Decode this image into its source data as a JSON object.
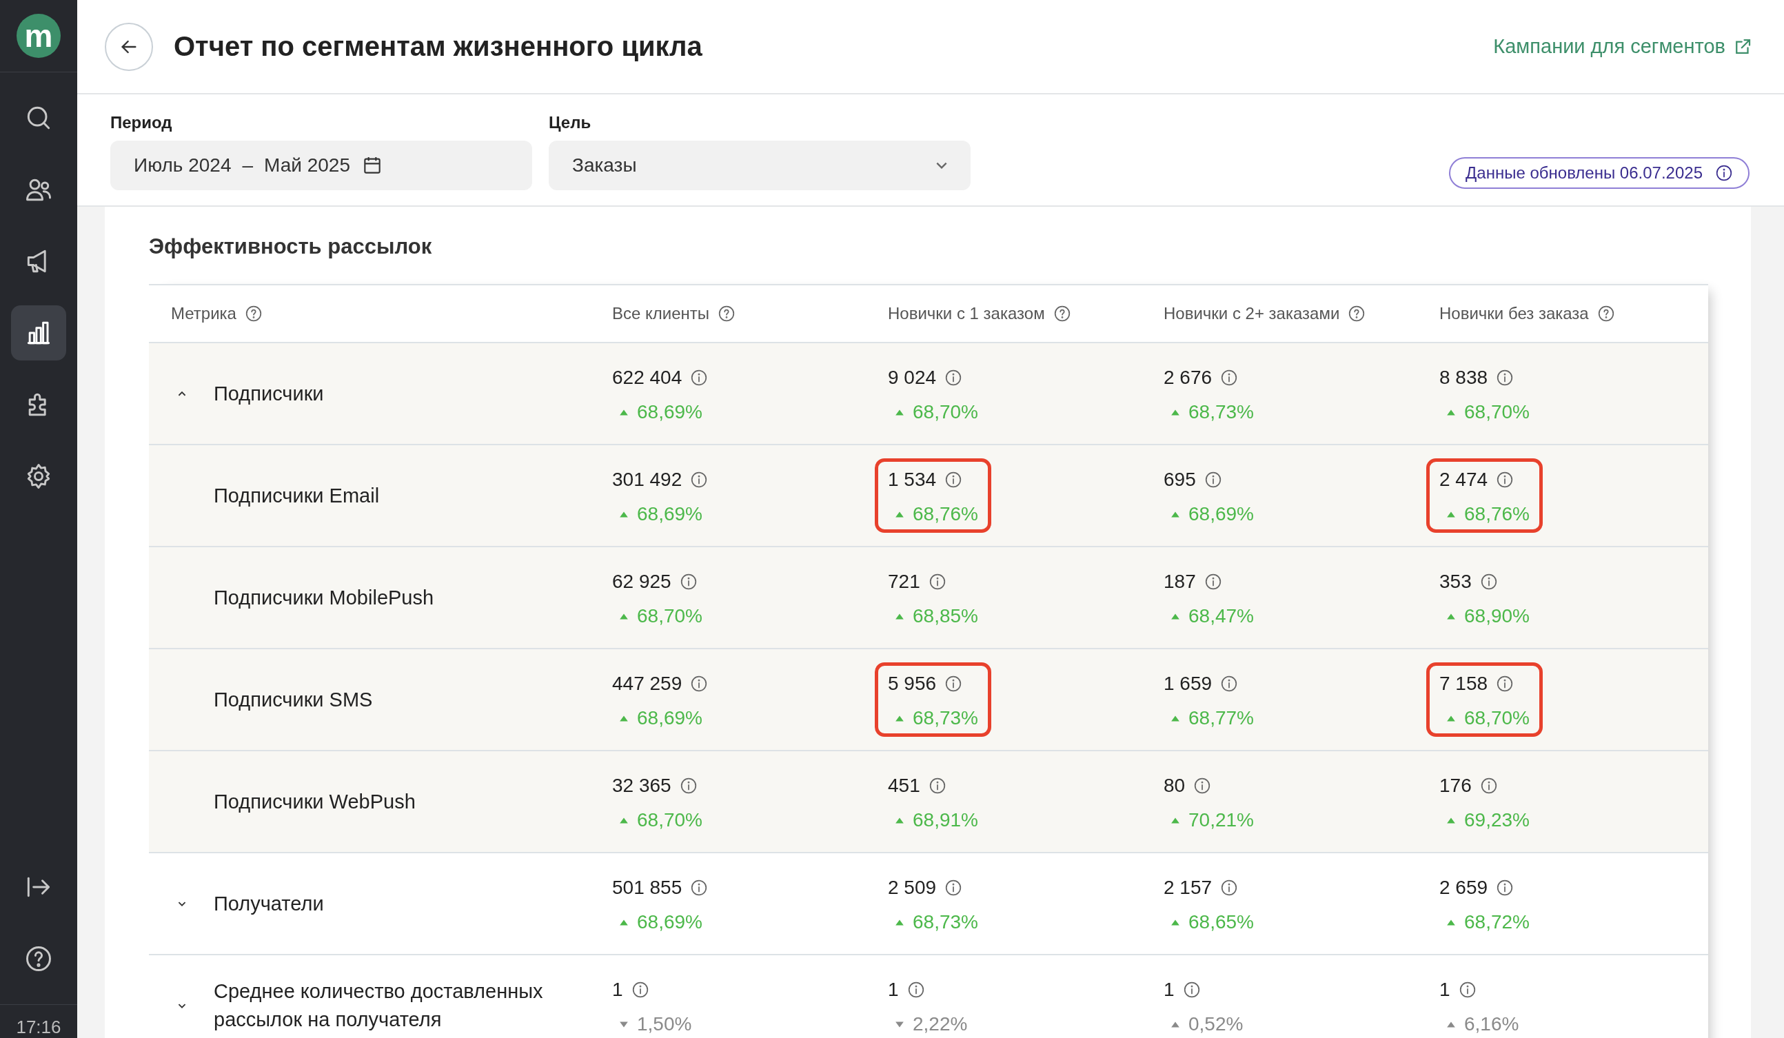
{
  "sidebar": {
    "logo": "m",
    "nav": [
      {
        "selected": false
      },
      {
        "selected": false
      },
      {
        "selected": false
      },
      {
        "selected": true
      },
      {
        "selected": false
      },
      {
        "selected": false
      }
    ],
    "time": "17:16"
  },
  "header": {
    "title": "Отчет по сегментам жизненного цикла",
    "link": "Кампании для сегментов"
  },
  "filters": {
    "period": {
      "label": "Период",
      "from": "Июль 2024",
      "separator": "–",
      "to": "Май 2025"
    },
    "goal": {
      "label": "Цель",
      "value": "Заказы"
    },
    "badge": "Данные обновлены 06.07.2025"
  },
  "card": {
    "title": "Эффективность рассылок",
    "metric_column": "Метрика",
    "columns": [
      "Все клиенты",
      "Новички с 1 заказом",
      "Новички с 2+ заказами",
      "Новички без заказа"
    ],
    "rows": [
      {
        "name": "Подписчики",
        "kind": "group",
        "expanded": true,
        "cells": [
          {
            "value": "622 404",
            "change": "68,69%",
            "kind": "up",
            "muted": false,
            "highlighted": false
          },
          {
            "value": "9 024",
            "change": "68,70%",
            "kind": "up",
            "muted": false,
            "highlighted": false
          },
          {
            "value": "2 676",
            "change": "68,73%",
            "kind": "up",
            "muted": false,
            "highlighted": false
          },
          {
            "value": "8 838",
            "change": "68,70%",
            "kind": "up",
            "muted": false,
            "highlighted": false
          }
        ]
      },
      {
        "name": "Подписчики Email",
        "kind": "child",
        "cells": [
          {
            "value": "301 492",
            "change": "68,69%",
            "kind": "up",
            "muted": false,
            "highlighted": false
          },
          {
            "value": "1 534",
            "change": "68,76%",
            "kind": "up",
            "muted": false,
            "highlighted": true
          },
          {
            "value": "695",
            "change": "68,69%",
            "kind": "up",
            "muted": false,
            "highlighted": false
          },
          {
            "value": "2 474",
            "change": "68,76%",
            "kind": "up",
            "muted": false,
            "highlighted": true
          }
        ]
      },
      {
        "name": "Подписчики MobilePush",
        "kind": "child",
        "cells": [
          {
            "value": "62 925",
            "change": "68,70%",
            "kind": "up",
            "muted": false,
            "highlighted": false
          },
          {
            "value": "721",
            "change": "68,85%",
            "kind": "up",
            "muted": false,
            "highlighted": false
          },
          {
            "value": "187",
            "change": "68,47%",
            "kind": "up",
            "muted": false,
            "highlighted": false
          },
          {
            "value": "353",
            "change": "68,90%",
            "kind": "up",
            "muted": false,
            "highlighted": false
          }
        ]
      },
      {
        "name": "Подписчики SMS",
        "kind": "child",
        "cells": [
          {
            "value": "447 259",
            "change": "68,69%",
            "kind": "up",
            "muted": false,
            "highlighted": false
          },
          {
            "value": "5 956",
            "change": "68,73%",
            "kind": "up",
            "muted": false,
            "highlighted": true
          },
          {
            "value": "1 659",
            "change": "68,77%",
            "kind": "up",
            "muted": false,
            "highlighted": false
          },
          {
            "value": "7 158",
            "change": "68,70%",
            "kind": "up",
            "muted": false,
            "highlighted": true
          }
        ]
      },
      {
        "name": "Подписчики WebPush",
        "kind": "child",
        "cells": [
          {
            "value": "32 365",
            "change": "68,70%",
            "kind": "up",
            "muted": false,
            "highlighted": false
          },
          {
            "value": "451",
            "change": "68,91%",
            "kind": "up",
            "muted": false,
            "highlighted": false
          },
          {
            "value": "80",
            "change": "70,21%",
            "kind": "up",
            "muted": false,
            "highlighted": false
          },
          {
            "value": "176",
            "change": "69,23%",
            "kind": "up",
            "muted": false,
            "highlighted": false
          }
        ]
      },
      {
        "name": "Получатели",
        "kind": "group",
        "expanded": false,
        "cells": [
          {
            "value": "501 855",
            "change": "68,69%",
            "kind": "up",
            "muted": false,
            "highlighted": false
          },
          {
            "value": "2 509",
            "change": "68,73%",
            "kind": "up",
            "muted": false,
            "highlighted": false
          },
          {
            "value": "2 157",
            "change": "68,65%",
            "kind": "up",
            "muted": false,
            "highlighted": false
          },
          {
            "value": "2 659",
            "change": "68,72%",
            "kind": "up",
            "muted": false,
            "highlighted": false
          }
        ]
      },
      {
        "name": "Среднее количество доставленных рассылок на получателя",
        "kind": "group",
        "expanded": false,
        "cells": [
          {
            "value": "1",
            "change": "1,50%",
            "kind": "down",
            "muted": true,
            "highlighted": false
          },
          {
            "value": "1",
            "change": "2,22%",
            "kind": "down",
            "muted": true,
            "highlighted": false
          },
          {
            "value": "1",
            "change": "0,52%",
            "kind": "up",
            "muted": true,
            "highlighted": false
          },
          {
            "value": "1",
            "change": "6,16%",
            "kind": "up",
            "muted": true,
            "highlighted": false
          }
        ]
      }
    ]
  }
}
